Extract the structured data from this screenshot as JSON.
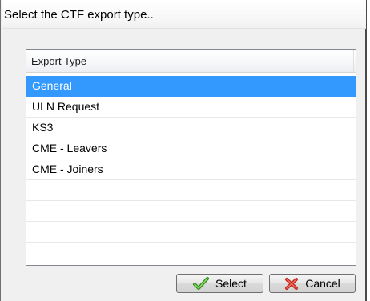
{
  "dialog": {
    "title": "Select the CTF export type.."
  },
  "list": {
    "column_header": "Export Type",
    "items": [
      "General",
      "ULN Request",
      "KS3",
      "CME - Leavers",
      "CME - Joiners"
    ],
    "empty_rows": 3,
    "selected": "General",
    "selection_color": "#3399ff"
  },
  "buttons": {
    "select_label": "Select",
    "select_icon": "green-checkmark-icon",
    "cancel_label": "Cancel",
    "cancel_icon": "red-x-icon"
  }
}
